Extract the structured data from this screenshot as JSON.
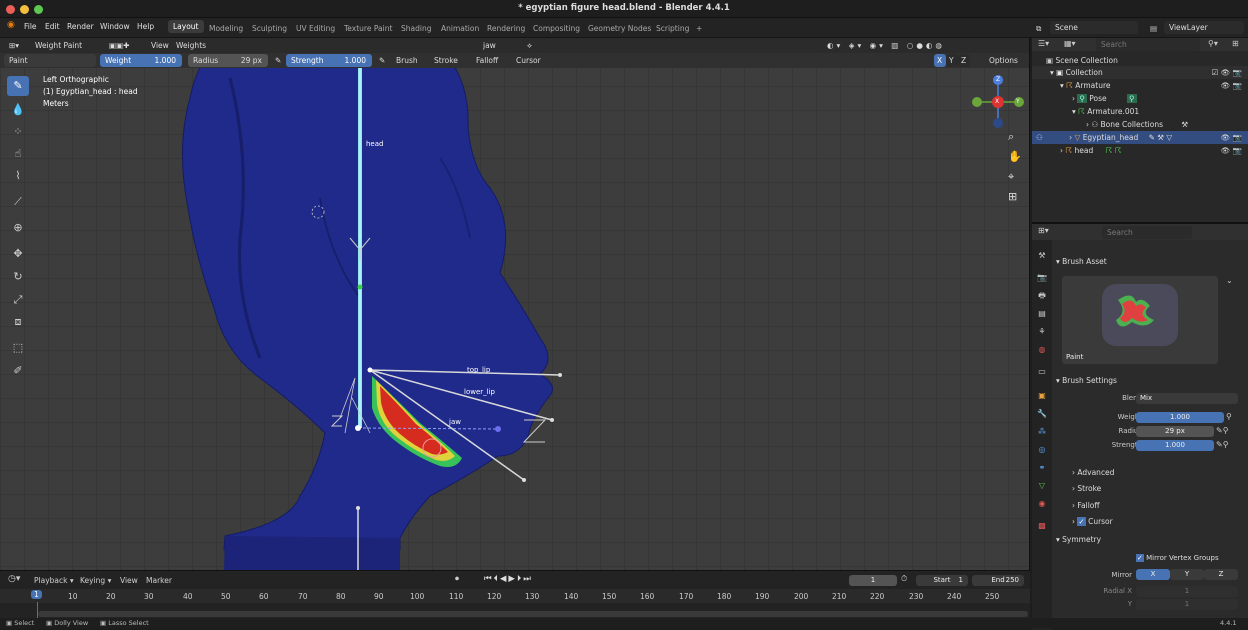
{
  "window": {
    "title": "* egyptian figure head.blend - Blender 4.4.1"
  },
  "menus": [
    "File",
    "Edit",
    "Render",
    "Window",
    "Help"
  ],
  "workspaces": [
    "Layout",
    "Modeling",
    "Sculpting",
    "UV Editing",
    "Texture Paint",
    "Shading",
    "Animation",
    "Rendering",
    "Compositing",
    "Geometry Nodes",
    "Scripting",
    "+"
  ],
  "active_workspace": "Layout",
  "scene": {
    "scene_name": "Scene",
    "view_layer": "ViewLayer"
  },
  "viewport_header": {
    "mode": "Weight Paint",
    "menus": [
      "View",
      "Weights"
    ],
    "bone_group": "jaw",
    "tool": "Paint",
    "weight_label": "Weight",
    "weight_value": "1.000",
    "radius_label": "Radius",
    "radius_value": "29 px",
    "strength_label": "Strength",
    "strength_value": "1.000",
    "dropdowns": [
      "Brush",
      "Stroke",
      "Falloff",
      "Cursor"
    ],
    "axes": [
      "X",
      "Y",
      "Z"
    ],
    "options": "Options"
  },
  "viewport_info": {
    "line1": "Left Orthographic",
    "line2": "(1) Egyptian_head : head",
    "line3": "Meters"
  },
  "bones": {
    "head": "head",
    "top_lip": "top_lip",
    "lower_lip": "lower_lip",
    "jaw": "jaw"
  },
  "gizmo": {
    "x": "X",
    "y": "Y",
    "z": "Z"
  },
  "outliner": {
    "search_placeholder": "Search",
    "rows": [
      {
        "label": "Scene Collection"
      },
      {
        "label": "Collection"
      },
      {
        "label": "Armature"
      },
      {
        "label": "Pose"
      },
      {
        "label": "Armature.001"
      },
      {
        "label": "Bone Collections"
      },
      {
        "label": "Egyptian_head"
      },
      {
        "label": "head"
      }
    ]
  },
  "properties": {
    "search_placeholder": "Search",
    "brush_asset_title": "Brush Asset",
    "brush_name": "Paint",
    "brush_settings_title": "Brush Settings",
    "blend_label": "Blend",
    "blend_value": "Mix",
    "weight_label": "Weight",
    "weight_value": "1.000",
    "radius_label": "Radius",
    "radius_value": "29 px",
    "strength_label": "Strength",
    "strength_value": "1.000",
    "subpanels": [
      "Advanced",
      "Stroke",
      "Falloff",
      "Cursor"
    ],
    "symmetry_title": "Symmetry",
    "mirror_vertex_groups": "Mirror Vertex Groups",
    "mirror_label": "Mirror",
    "mirror_axes": [
      "X",
      "Y",
      "Z"
    ],
    "radial_x_label": "Radial X",
    "radial_y_label": "Y",
    "radial_x_value": "1",
    "radial_y_value": "1"
  },
  "timeline": {
    "menus": [
      "Playback",
      "Keying",
      "View",
      "Marker"
    ],
    "current_frame": "1",
    "start_label": "Start",
    "start_value": "1",
    "end_label": "End",
    "end_value": "250",
    "ticks": [
      "10",
      "20",
      "30",
      "40",
      "50",
      "60",
      "70",
      "80",
      "90",
      "100",
      "110",
      "120",
      "130",
      "140",
      "150",
      "160",
      "170",
      "180",
      "190",
      "200",
      "210",
      "220",
      "230",
      "240",
      "250"
    ],
    "playhead": "1"
  },
  "statusbar": {
    "items": [
      "Select",
      "Dolly View",
      "Lasso Select"
    ],
    "version": "4.4.1"
  },
  "colors": {
    "accent": "#4772b3",
    "mesh": "#1f2a8a",
    "weight_hot": "#d62b1f",
    "bone_cyan": "#8fe6ee"
  }
}
